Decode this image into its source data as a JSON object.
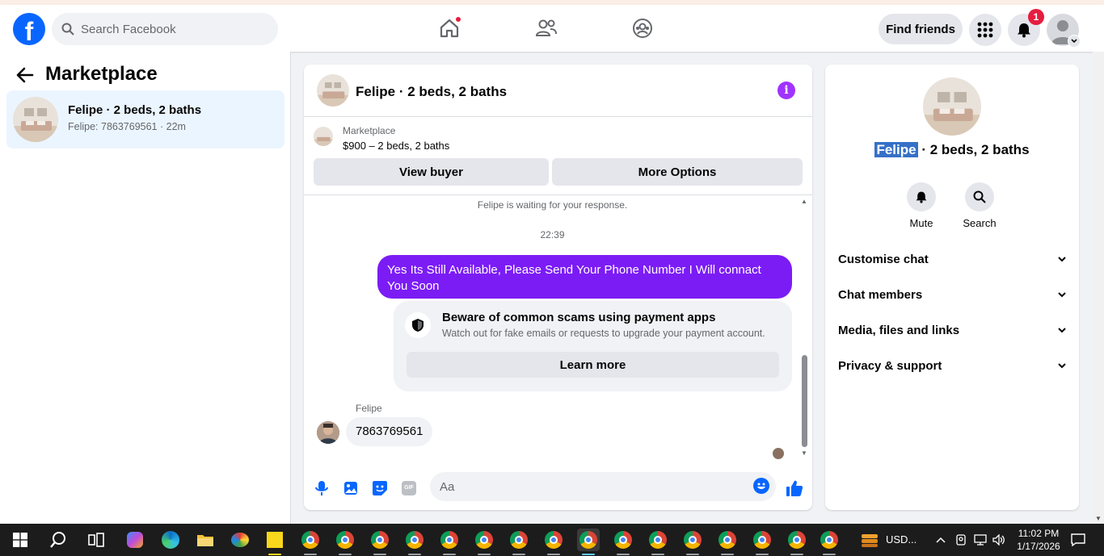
{
  "header": {
    "search_placeholder": "Search Facebook",
    "find_friends_label": "Find friends",
    "notification_count": "1"
  },
  "sidebar": {
    "title": "Marketplace",
    "conversations": [
      {
        "title": "Felipe · 2 beds, 2 baths",
        "subtitle": "Felipe: 7863769561 · 22m"
      }
    ]
  },
  "chat": {
    "header_title": "Felipe · 2 beds, 2 baths",
    "marketplace_label": "Marketplace",
    "listing_price": "$900 – 2 beds, 2 baths",
    "view_buyer_label": "View buyer",
    "more_options_label": "More Options",
    "waiting_text": "Felipe is waiting for your response.",
    "timestamp": "22:39",
    "outgoing_message": "Yes Its Still Available, Please Send Your Phone Number I Will connact You Soon",
    "scam_title": "Beware of common scams using payment apps",
    "scam_desc": "Watch out for fake emails or requests to upgrade your payment account.",
    "learn_more_label": "Learn more",
    "sender_name": "Felipe",
    "incoming_message": "7863769561",
    "composer_placeholder": "Aa",
    "gif_label": "GIF"
  },
  "right_panel": {
    "name_selected": "Felipe",
    "name_rest": " · 2 beds, 2 baths",
    "actions": [
      {
        "label": "Mute"
      },
      {
        "label": "Search"
      }
    ],
    "sections": [
      {
        "label": "Customise chat"
      },
      {
        "label": "Chat members"
      },
      {
        "label": "Media, files and links"
      },
      {
        "label": "Privacy & support"
      }
    ]
  },
  "taskbar": {
    "usd_label": "USD...",
    "time": "11:02 PM",
    "date": "1/17/2026"
  },
  "colors": {
    "facebook_blue": "#0866ff",
    "messenger_purple": "#7b1cf5",
    "notification_red": "#e41e3f"
  }
}
